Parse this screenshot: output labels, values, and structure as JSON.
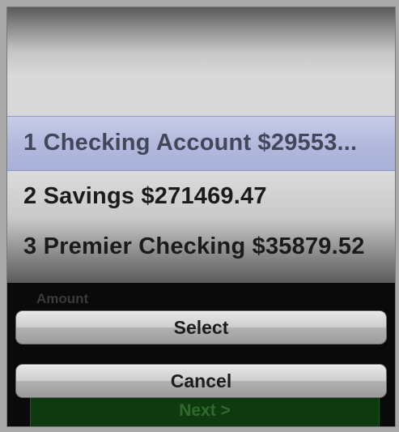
{
  "picker": {
    "options": [
      {
        "label": "1 Checking Account $29553..."
      },
      {
        "label": "2 Savings $271469.47"
      },
      {
        "label": "3 Premier Checking $35879.52"
      }
    ],
    "selected_index": 0
  },
  "form": {
    "amount_label": "Amount",
    "next_label": "Next >"
  },
  "actions": {
    "select_label": "Select",
    "cancel_label": "Cancel"
  },
  "colors": {
    "selection_bar": "#b3badf",
    "next_button": "#0f3a0f"
  }
}
